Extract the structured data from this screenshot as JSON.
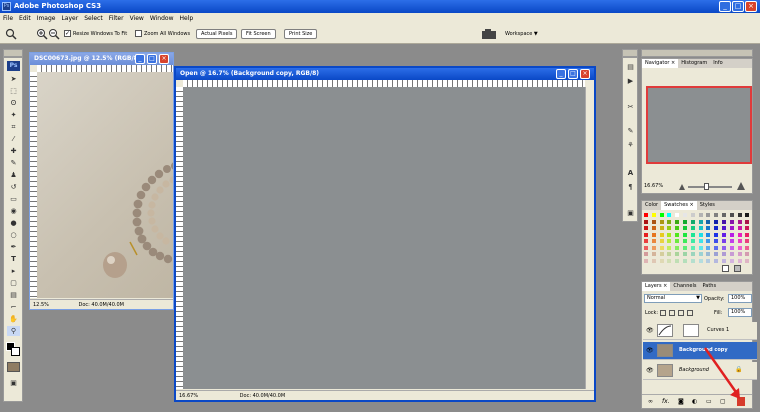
{
  "app": {
    "title": "Adobe Photoshop CS3",
    "ps_badge": "Ps",
    "min": "_",
    "max": "□",
    "close": "×"
  },
  "menu": [
    "File",
    "Edit",
    "Image",
    "Layer",
    "Select",
    "Filter",
    "View",
    "Window",
    "Help"
  ],
  "options": {
    "resize_windows": "Resize Windows To Fit",
    "zoom_all": "Zoom All Windows",
    "actual_pixels": "Actual Pixels",
    "fit_screen": "Fit Screen",
    "print_size": "Print Size",
    "workspace": "Workspace ▼",
    "check": "✓"
  },
  "doc1": {
    "title": "DSC00673.jpg @ 12.5% (RGB/8)",
    "zoom": "12.5%",
    "status": "Doc: 40.0M/40.0M"
  },
  "doc2": {
    "title": "Open @ 16.7% (Background copy, RGB/8)",
    "zoom": "16.67%",
    "status": "Doc: 40.0M/40.0M"
  },
  "navigator": {
    "tabs": [
      "Navigator ×",
      "Histogram",
      "Info"
    ],
    "zoom": "16.67%"
  },
  "color_panel": {
    "tabs": [
      "Color",
      "Swatches ×",
      "Styles"
    ]
  },
  "layers_panel": {
    "tabs": [
      "Layers ×",
      "Channels",
      "Paths"
    ],
    "blend_mode": "Normal",
    "opacity_label": "Opacity:",
    "opacity": "100%",
    "lock_label": "Lock:",
    "fill_label": "Fill:",
    "fill": "100%",
    "layers": [
      "Curves 1",
      "Background copy",
      "Background"
    ]
  },
  "colors": {
    "title_active": "#0a48c6",
    "chrome": "#ece9d8",
    "canvas": "#8b8f91",
    "selected": "#316ac5",
    "arrow": "#e02020"
  }
}
